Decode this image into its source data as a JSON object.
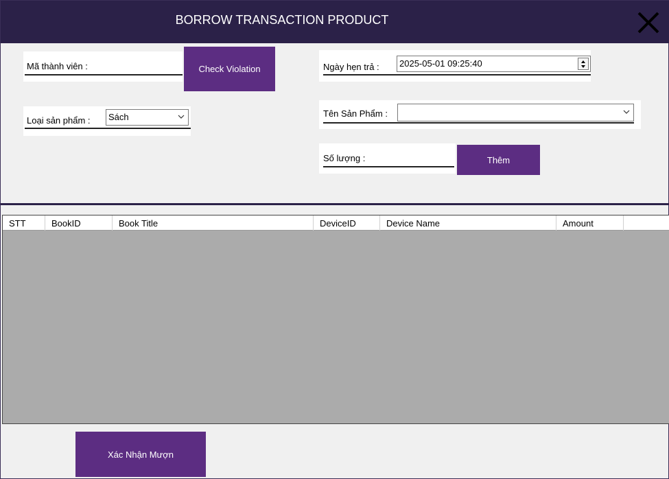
{
  "window": {
    "title": "BORROW TRANSACTION PRODUCT"
  },
  "form": {
    "member_id_label": "Mã thành viên :",
    "check_violation_label": "Check Violation",
    "due_date_label": "Ngày hẹn trả :",
    "due_date_value": "2025-05-01 09:25:40",
    "product_type_label": "Loại sản phẩm :",
    "product_type_value": "Sách",
    "product_name_label": "Tên Sản Phẩm :",
    "product_name_value": "",
    "quantity_label": "Số lượng :",
    "add_label": "Thêm"
  },
  "table": {
    "columns": [
      "STT",
      "BookID",
      "Book Title",
      "DeviceID",
      "Device Name",
      "Amount",
      ""
    ],
    "rows": []
  },
  "footer": {
    "confirm_label": "Xác Nhận Mượn"
  },
  "colors": {
    "titlebar": "#2b2148",
    "accent": "#5c2d82",
    "grid_background": "#ababab"
  }
}
